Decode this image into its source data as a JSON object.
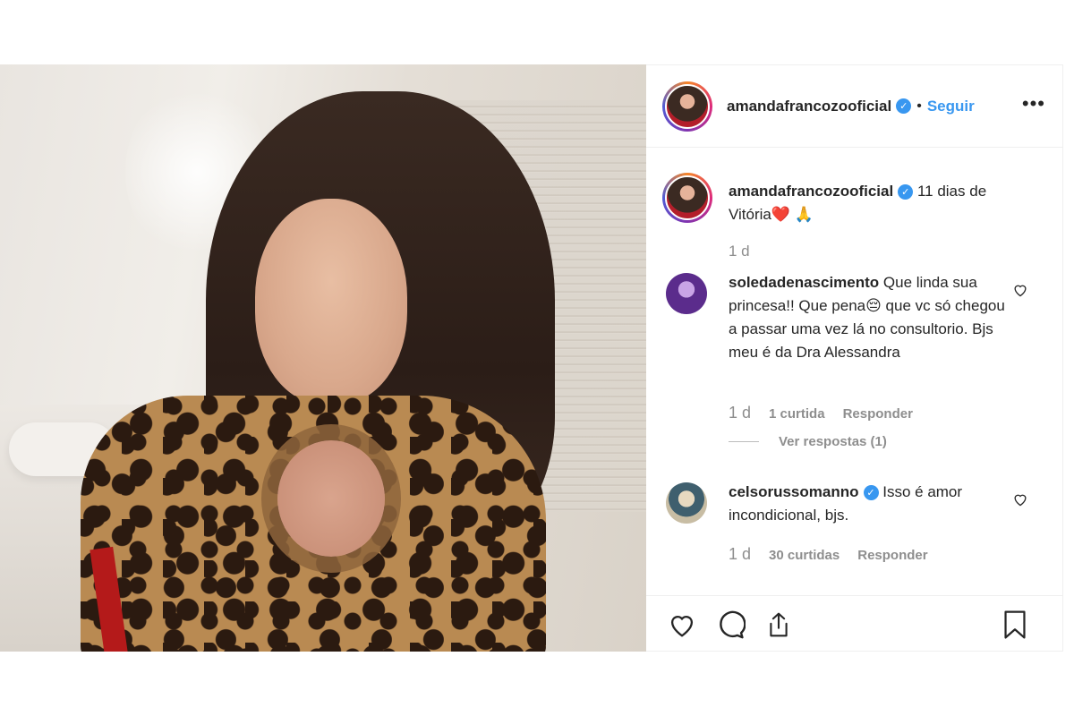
{
  "post": {
    "username": "amandafrancozooficial",
    "separator": "•",
    "follow_label": "Seguir",
    "more_label": "•••",
    "caption": "11 dias de Vitória❤️ 🙏",
    "caption_time": "1 d",
    "verified_mark": "✓"
  },
  "comments": [
    {
      "username": "soledadenascimento",
      "text": "Que linda sua princesa!! Que pena😔 que vc só chegou a passar uma vez lá no consultorio. Bjs meu é da Dra Alessandra",
      "time": "1 d",
      "likes": "1 curtida",
      "reply_label": "Responder",
      "view_replies": "Ver respostas (1)"
    },
    {
      "username": "celsorussomanno",
      "text": "Isso é amor incondicional, bjs.",
      "time": "1 d",
      "likes": "30 curtidas",
      "reply_label": "Responder"
    }
  ],
  "colors": {
    "accent": "#3897f0",
    "muted": "#8e8e8e",
    "text": "#262626",
    "border": "#efefef"
  },
  "icons": {
    "like": "heart-icon",
    "comment": "comment-icon",
    "share": "share-icon",
    "save": "bookmark-icon"
  }
}
